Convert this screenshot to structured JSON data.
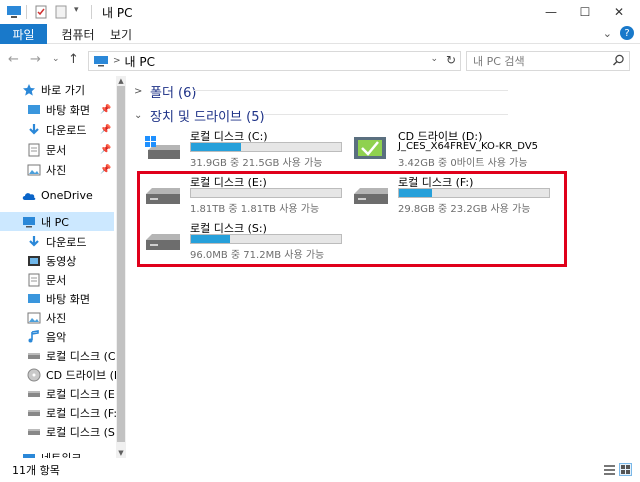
{
  "window": {
    "title": "내 PC",
    "minimize": "—",
    "maximize": "☐",
    "close": "✕"
  },
  "ribbon": {
    "tabs": [
      "파일",
      "컴퓨터",
      "보기"
    ],
    "expand": "⌄",
    "help": "?"
  },
  "nav": {
    "back": "←",
    "forward": "→",
    "dropdown": "⌄",
    "up": "↑"
  },
  "address": {
    "crumb": "내 PC",
    "caret": ">",
    "dropdown": "⌄",
    "refresh": "↻"
  },
  "search": {
    "placeholder": "내 PC 검색"
  },
  "sidebar": {
    "items": [
      {
        "label": "바로 가기",
        "icon": "star-icon"
      },
      {
        "label": "바탕 화면",
        "icon": "desktop-icon",
        "pinned": true
      },
      {
        "label": "다운로드",
        "icon": "download-icon",
        "pinned": true
      },
      {
        "label": "문서",
        "icon": "document-icon",
        "pinned": true
      },
      {
        "label": "사진",
        "icon": "pictures-icon",
        "pinned": true
      },
      {
        "label": "OneDrive",
        "icon": "cloud-icon"
      },
      {
        "label": "내 PC",
        "icon": "pc-icon"
      },
      {
        "label": "다운로드",
        "icon": "download-icon"
      },
      {
        "label": "동영상",
        "icon": "video-icon"
      },
      {
        "label": "문서",
        "icon": "document-icon"
      },
      {
        "label": "바탕 화면",
        "icon": "desktop-icon"
      },
      {
        "label": "사진",
        "icon": "pictures-icon"
      },
      {
        "label": "음악",
        "icon": "music-icon"
      },
      {
        "label": "로컬 디스크 (C:)",
        "icon": "drive-icon"
      },
      {
        "label": "CD 드라이브 (D",
        "icon": "cd-icon"
      },
      {
        "label": "로컬 디스크 (E:)",
        "icon": "drive-icon"
      },
      {
        "label": "로컬 디스크 (F:)",
        "icon": "drive-icon"
      },
      {
        "label": "로컬 디스크 (S:)",
        "icon": "drive-icon"
      },
      {
        "label": "네트워크",
        "icon": "network-icon"
      }
    ],
    "pin_glyph": "📌"
  },
  "content": {
    "folders_header": "폴더 (6)",
    "devices_header": "장치 및 드라이브 (5)",
    "chevron_collapsed": ">",
    "chevron_expanded": "⌄",
    "drives": [
      {
        "name": "로컬 디스크 (C:)",
        "free_text": "31.9GB 중 21.5GB 사용 가능",
        "used_fraction": 0.33
      },
      {
        "name": "CD 드라이브 (D:)",
        "volume": "J_CES_X64FREV_KO-KR_DV5",
        "free_text": "3.42GB 중 0바이트 사용 가능"
      },
      {
        "name": "로컬 디스크 (E:)",
        "free_text": "1.81TB 중 1.81TB 사용 가능",
        "used_fraction": 0.0
      },
      {
        "name": "로컬 디스크 (F:)",
        "free_text": "29.8GB 중 23.2GB 사용 가능",
        "used_fraction": 0.22
      },
      {
        "name": "로컬 디스크 (S:)",
        "free_text": "96.0MB 중 71.2MB 사용 가능",
        "used_fraction": 0.26
      }
    ]
  },
  "status": {
    "item_count": "11개 항목"
  },
  "colors": {
    "accent": "#1979ca",
    "selection": "#cce8ff",
    "usage_bar": "#26a0da",
    "highlight_border": "#e0001b",
    "group_header": "#1e3287"
  }
}
